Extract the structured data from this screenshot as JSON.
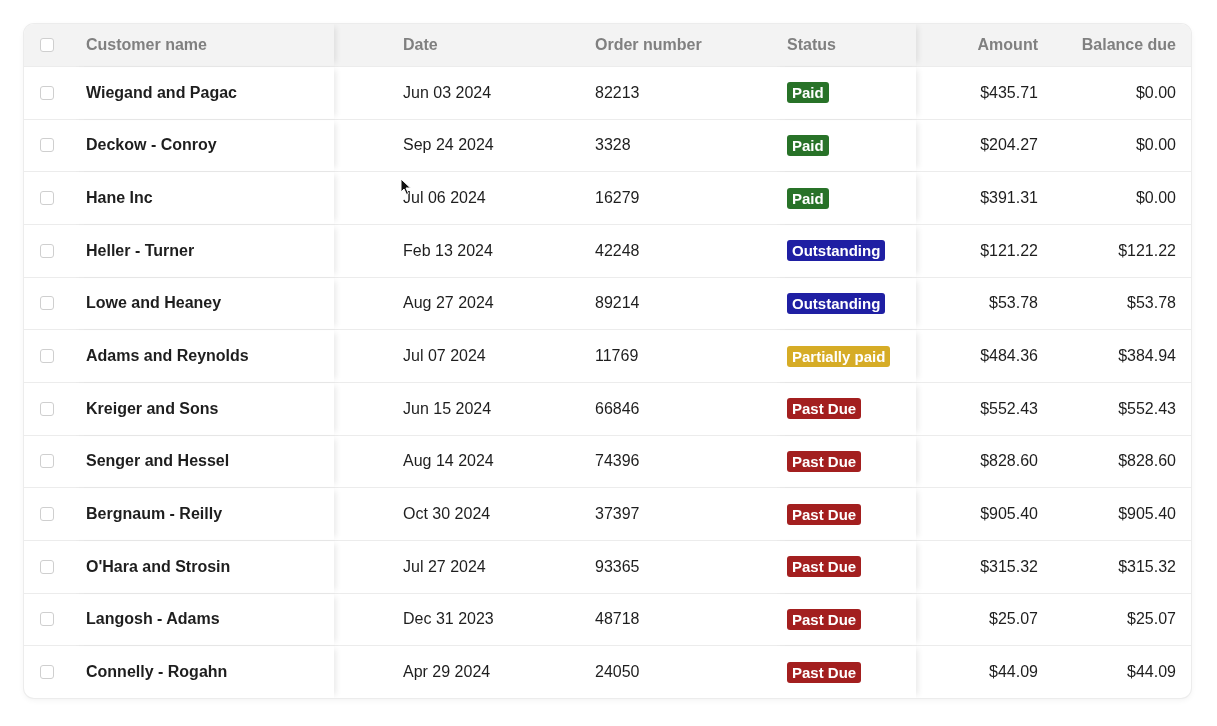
{
  "table": {
    "select_all": {
      "checked": false
    },
    "columns": [
      "Customer name",
      "Date",
      "Order number",
      "Status",
      "Amount",
      "Balance due"
    ],
    "rows": [
      {
        "checked": false,
        "customer": "Wiegand and Pagac",
        "date": "Jun 03 2024",
        "order": "82213",
        "status": {
          "label": "Paid",
          "color": "#287228"
        },
        "amount": "$435.71",
        "balance": "$0.00"
      },
      {
        "checked": false,
        "customer": "Deckow - Conroy",
        "date": "Sep 24 2024",
        "order": "3328",
        "status": {
          "label": "Paid",
          "color": "#287228"
        },
        "amount": "$204.27",
        "balance": "$0.00"
      },
      {
        "checked": false,
        "customer": "Hane Inc",
        "date": "Jul 06 2024",
        "order": "16279",
        "status": {
          "label": "Paid",
          "color": "#287228"
        },
        "amount": "$391.31",
        "balance": "$0.00"
      },
      {
        "checked": false,
        "customer": "Heller - Turner",
        "date": "Feb 13 2024",
        "order": "42248",
        "status": {
          "label": "Outstanding",
          "color": "#1f1fa3"
        },
        "amount": "$121.22",
        "balance": "$121.22"
      },
      {
        "checked": false,
        "customer": "Lowe and Heaney",
        "date": "Aug 27 2024",
        "order": "89214",
        "status": {
          "label": "Outstanding",
          "color": "#1f1fa3"
        },
        "amount": "$53.78",
        "balance": "$53.78"
      },
      {
        "checked": false,
        "customer": "Adams and Reynolds",
        "date": "Jul 07 2024",
        "order": "11769",
        "status": {
          "label": "Partially paid",
          "color": "#d6ac26"
        },
        "amount": "$484.36",
        "balance": "$384.94"
      },
      {
        "checked": false,
        "customer": "Kreiger and Sons",
        "date": "Jun 15 2024",
        "order": "66846",
        "status": {
          "label": "Past Due",
          "color": "#a31f1f"
        },
        "amount": "$552.43",
        "balance": "$552.43"
      },
      {
        "checked": false,
        "customer": "Senger and Hessel",
        "date": "Aug 14 2024",
        "order": "74396",
        "status": {
          "label": "Past Due",
          "color": "#a31f1f"
        },
        "amount": "$828.60",
        "balance": "$828.60"
      },
      {
        "checked": false,
        "customer": "Bergnaum - Reilly",
        "date": "Oct 30 2024",
        "order": "37397",
        "status": {
          "label": "Past Due",
          "color": "#a31f1f"
        },
        "amount": "$905.40",
        "balance": "$905.40"
      },
      {
        "checked": false,
        "customer": "O'Hara and Strosin",
        "date": "Jul 27 2024",
        "order": "93365",
        "status": {
          "label": "Past Due",
          "color": "#a31f1f"
        },
        "amount": "$315.32",
        "balance": "$315.32"
      },
      {
        "checked": false,
        "customer": "Langosh - Adams",
        "date": "Dec 31 2023",
        "order": "48718",
        "status": {
          "label": "Past Due",
          "color": "#a31f1f"
        },
        "amount": "$25.07",
        "balance": "$25.07"
      },
      {
        "checked": false,
        "customer": "Connelly - Rogahn",
        "date": "Apr 29 2024",
        "order": "24050",
        "status": {
          "label": "Past Due",
          "color": "#a31f1f"
        },
        "amount": "$44.09",
        "balance": "$44.09"
      }
    ]
  }
}
